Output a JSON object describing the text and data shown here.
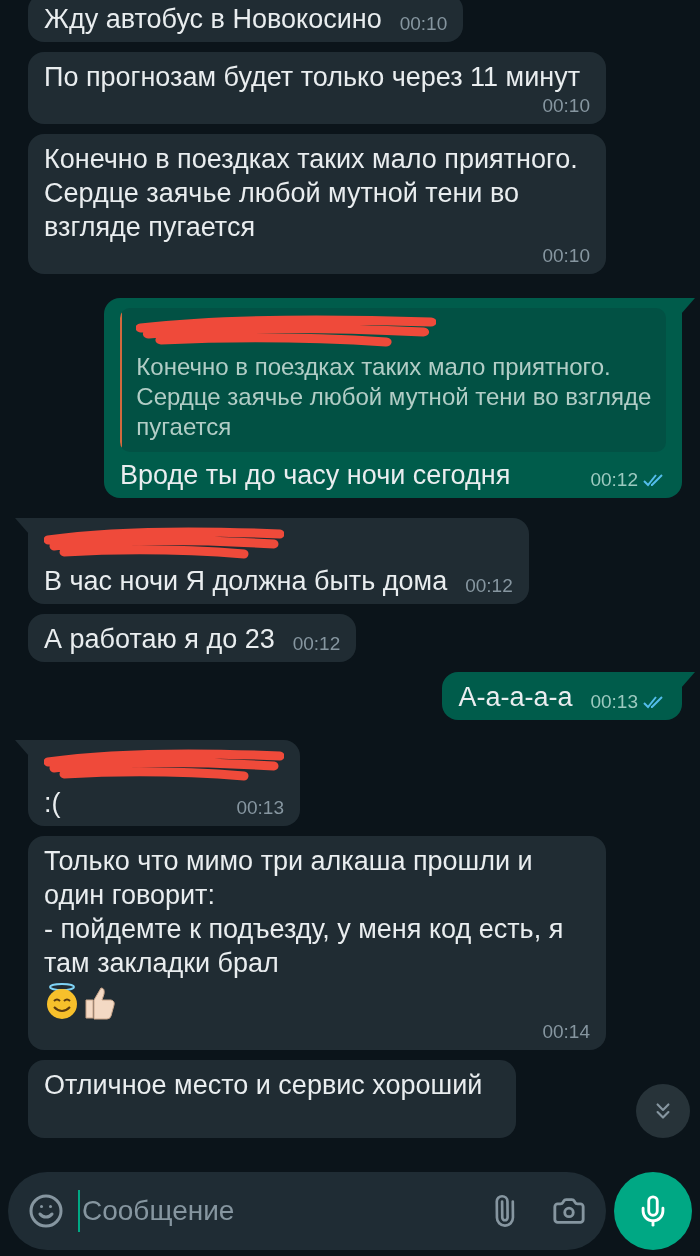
{
  "messages": [
    {
      "kind": "incoming",
      "tail": false,
      "text": "Жду автобус в Новокосино",
      "time": "00:10"
    },
    {
      "kind": "incoming",
      "tail": false,
      "text": "По прогнозам будет только через 11 минут",
      "time": "00:10"
    },
    {
      "kind": "incoming",
      "tail": false,
      "text": "Конечно в поездках таких мало приятного. Сердце заячье любой мутной тени во взгляде пугается",
      "time": "00:10"
    },
    {
      "kind": "outgoing",
      "tail": true,
      "quote": {
        "sender_hidden": true,
        "text": "Конечно в поездках таких мало приятного. Сердце заячье любой мутной тени во взгляде пугается"
      },
      "text": "Вроде ты до часу ночи сегодня",
      "time": "00:12",
      "read": true
    },
    {
      "kind": "incoming",
      "tail": true,
      "sender_hidden": true,
      "text": "В час ночи Я должна быть дома",
      "time": "00:12"
    },
    {
      "kind": "incoming",
      "tail": false,
      "text": "А работаю я до 23",
      "time": "00:12"
    },
    {
      "kind": "outgoing",
      "tail": true,
      "text": "А-а-а-а-а",
      "time": "00:13",
      "read": true
    },
    {
      "kind": "incoming",
      "tail": true,
      "sender_hidden": true,
      "text": ":(",
      "time": "00:13"
    },
    {
      "kind": "incoming",
      "tail": false,
      "text": "Только что мимо три алкаша прошли и один говорит:\n- пойдемте к подъезду, у меня код есть, я там закладки брал",
      "emoji": [
        {
          "kind": "smile-halo"
        },
        {
          "kind": "thumbs-up"
        }
      ],
      "time": "00:14"
    },
    {
      "kind": "incoming",
      "tail": false,
      "text": "Отличное место и сервис хороший"
    }
  ],
  "composer": {
    "placeholder": "Сообщение"
  }
}
